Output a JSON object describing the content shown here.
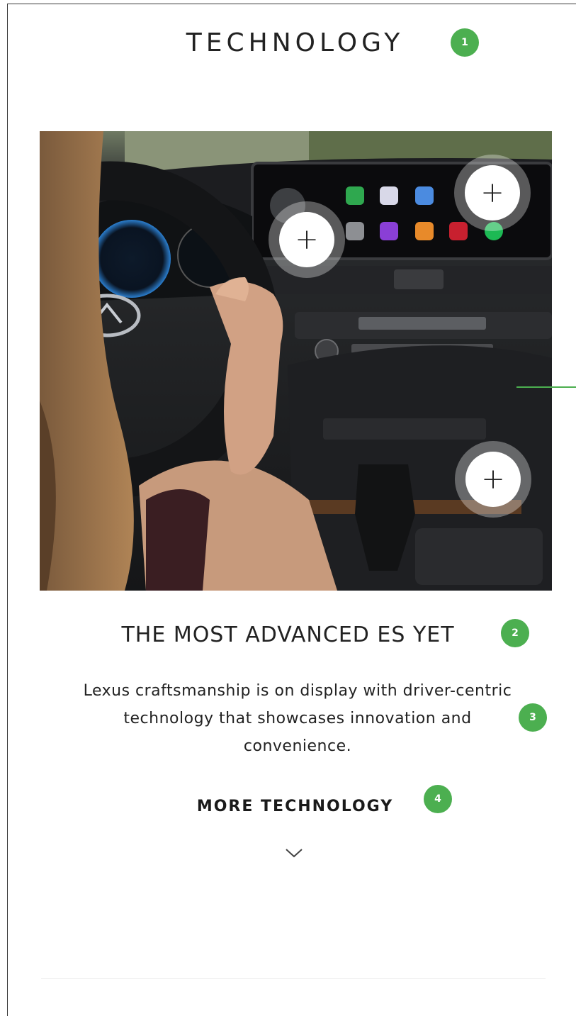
{
  "section": {
    "title": "TECHNOLOGY"
  },
  "badges": {
    "b1": "1",
    "b2": "2",
    "b3": "3",
    "b4": "4"
  },
  "hotspots": {
    "symbol": "+"
  },
  "feature": {
    "headline": "THE MOST ADVANCED ES YET",
    "description": "Lexus craftsmanship is on display with driver-centric technology that showcases innovation and convenience."
  },
  "cta": {
    "more_label": "MORE TECHNOLOGY"
  },
  "colors": {
    "accent": "#4caf50",
    "text": "#1a1a1a"
  },
  "icons": {
    "expand": "chevron-down-icon",
    "hotspot": "plus-icon"
  }
}
